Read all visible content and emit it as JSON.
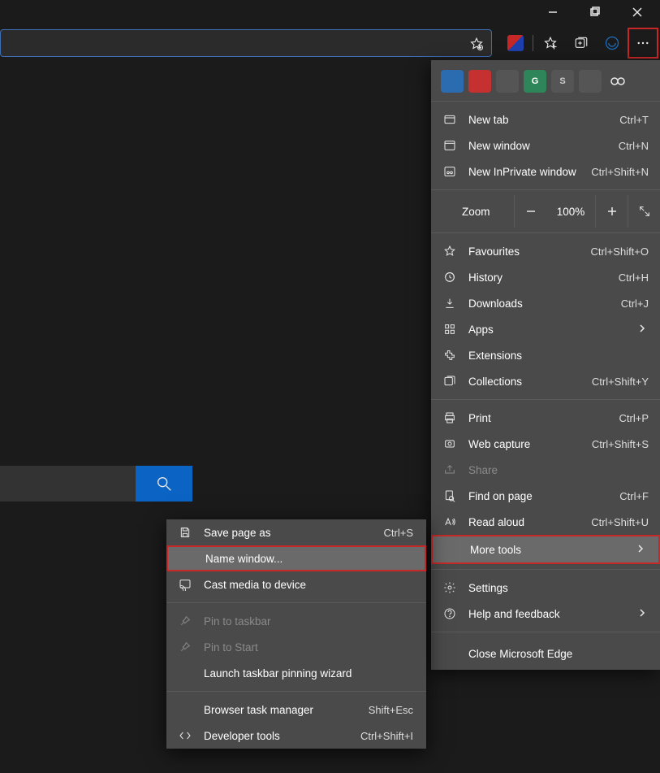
{
  "window_controls": {
    "minimize": "−",
    "maximize": "▢",
    "close": "✕"
  },
  "toolbar": {
    "star_title": "Add this page to favourites"
  },
  "extensionRow": [
    {
      "bg": "#2b6cb0",
      "name": "ext-1"
    },
    {
      "bg": "#c53030",
      "name": "ext-2"
    },
    {
      "bg": "#555",
      "name": "ext-3"
    },
    {
      "bg": "#2f855a",
      "text": "G",
      "name": "ext-grammarly"
    },
    {
      "bg": "#555",
      "text": "S",
      "name": "ext-s"
    },
    {
      "bg": "#555",
      "name": "ext-ublock"
    },
    {
      "bg": "#555",
      "name": "ext-eyes"
    }
  ],
  "menu": {
    "newTab": {
      "label": "New tab",
      "shortcut": "Ctrl+T"
    },
    "newWindow": {
      "label": "New window",
      "shortcut": "Ctrl+N"
    },
    "newInprivate": {
      "label": "New InPrivate window",
      "shortcut": "Ctrl+Shift+N"
    },
    "zoom": {
      "label": "Zoom",
      "value": "100%"
    },
    "favourites": {
      "label": "Favourites",
      "shortcut": "Ctrl+Shift+O"
    },
    "history": {
      "label": "History",
      "shortcut": "Ctrl+H"
    },
    "downloads": {
      "label": "Downloads",
      "shortcut": "Ctrl+J"
    },
    "apps": {
      "label": "Apps"
    },
    "extensions": {
      "label": "Extensions"
    },
    "collections": {
      "label": "Collections",
      "shortcut": "Ctrl+Shift+Y"
    },
    "print": {
      "label": "Print",
      "shortcut": "Ctrl+P"
    },
    "webCapture": {
      "label": "Web capture",
      "shortcut": "Ctrl+Shift+S"
    },
    "share": {
      "label": "Share"
    },
    "find": {
      "label": "Find on page",
      "shortcut": "Ctrl+F"
    },
    "readAloud": {
      "label": "Read aloud",
      "shortcut": "Ctrl+Shift+U"
    },
    "moreTools": {
      "label": "More tools"
    },
    "settings": {
      "label": "Settings"
    },
    "help": {
      "label": "Help and feedback"
    },
    "close": {
      "label": "Close Microsoft Edge"
    }
  },
  "submenu": {
    "savePage": {
      "label": "Save page as",
      "shortcut": "Ctrl+S"
    },
    "nameWindow": {
      "label": "Name window..."
    },
    "cast": {
      "label": "Cast media to device"
    },
    "pinTaskbar": {
      "label": "Pin to taskbar"
    },
    "pinStart": {
      "label": "Pin to Start"
    },
    "launchWizard": {
      "label": "Launch taskbar pinning wizard"
    },
    "taskManager": {
      "label": "Browser task manager",
      "shortcut": "Shift+Esc"
    },
    "devTools": {
      "label": "Developer tools",
      "shortcut": "Ctrl+Shift+I"
    }
  }
}
